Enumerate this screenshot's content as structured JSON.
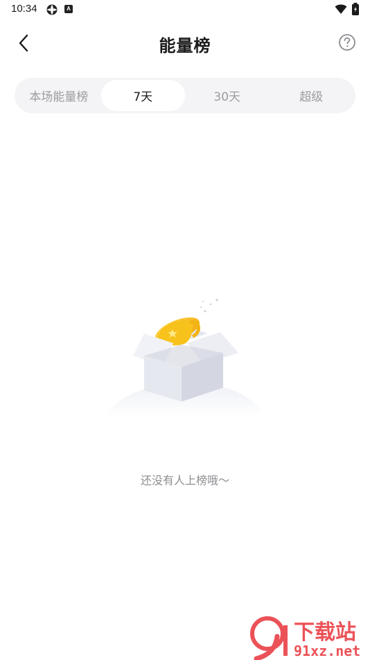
{
  "status_bar": {
    "time": "10:34",
    "icons": [
      "settings-gear-status-icon",
      "app-a-status-icon",
      "wifi-icon",
      "battery-icon"
    ],
    "app_badge_letter": "A"
  },
  "header": {
    "title": "能量榜",
    "back_icon": "chevron-left-icon",
    "help_icon": "question-circle-icon"
  },
  "tabs": [
    {
      "label": "本场能量榜",
      "active": false
    },
    {
      "label": "7天",
      "active": true
    },
    {
      "label": "30天",
      "active": false
    },
    {
      "label": "超级",
      "active": false
    }
  ],
  "empty_state": {
    "message": "还没有人上榜哦～",
    "illustration": "open-box-with-trophy-icon"
  },
  "watermark": {
    "brand_text": "下载站",
    "url_text": "91xz.net",
    "logo_text": "9"
  },
  "colors": {
    "tab_bar_bg": "#f4f4f6",
    "active_tab_bg": "#ffffff",
    "inactive_tab_text": "#9c9ca1",
    "trophy_yellow": "#f7c21c",
    "watermark_red": "#e8343c"
  }
}
